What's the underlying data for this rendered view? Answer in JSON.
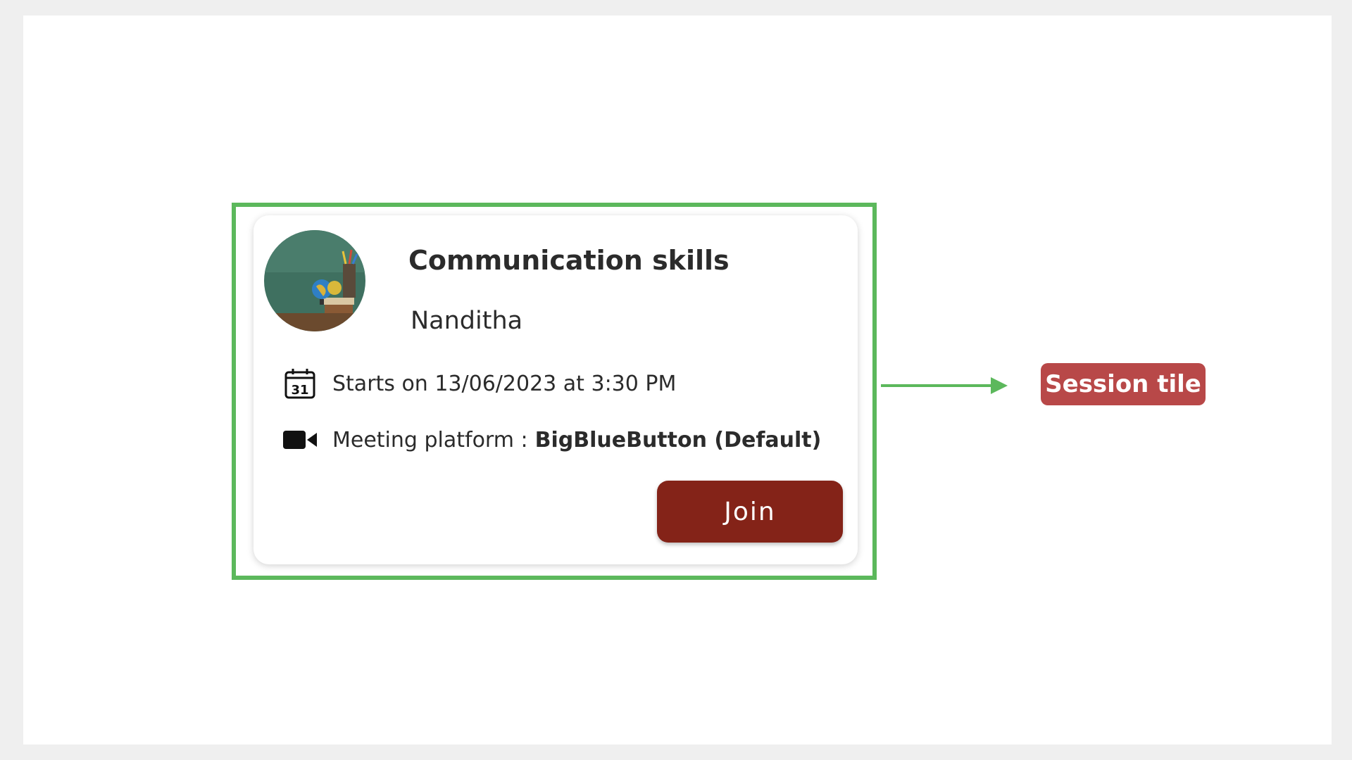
{
  "session_tile": {
    "title": "Communication skills",
    "mentor_name": "Nanditha",
    "date_text": "Starts on 13/06/2023 at 3:30 PM",
    "calendar_day": "31",
    "platform_label": "Meeting platform :",
    "platform_value": "BigBlueButton (Default)",
    "join_label": "Join"
  },
  "annotation": {
    "callout_label": "Session tile"
  },
  "colors": {
    "highlight": "#5cb85c",
    "join_button": "#842318",
    "callout": "#b84848"
  },
  "icons": [
    "calendar-icon",
    "video-camera-icon",
    "arrow-right-icon"
  ]
}
